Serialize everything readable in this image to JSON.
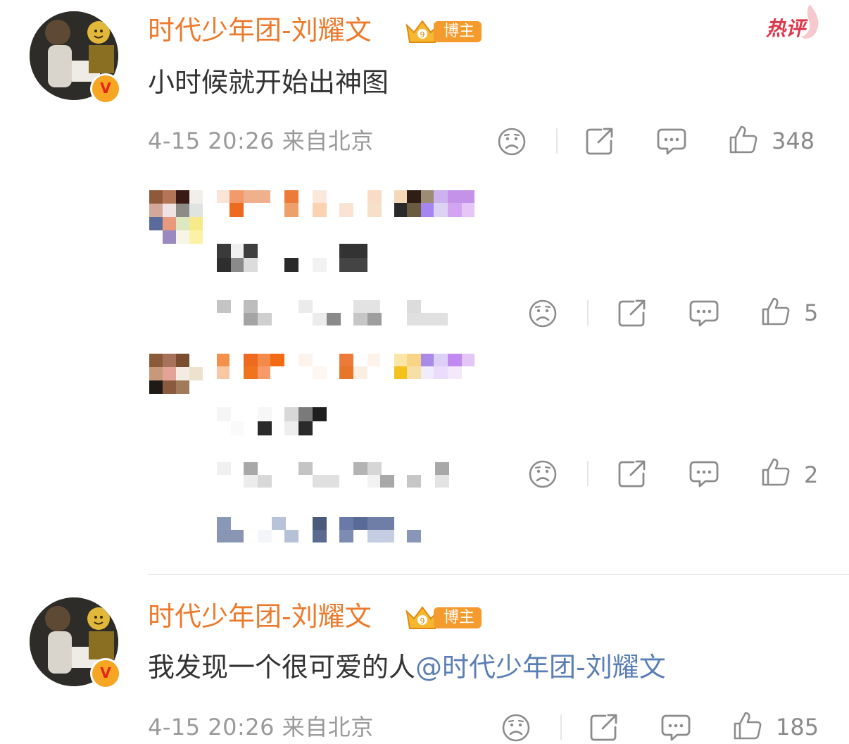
{
  "hot_tag": "热评",
  "comments": [
    {
      "author": "时代少年团-刘耀文",
      "badge": "博主",
      "text": "小时候就开始出神图",
      "meta": "4-15 20:26 来自北京",
      "likes": "348"
    },
    {
      "author": "时代少年团-刘耀文",
      "badge": "博主",
      "text": "我发现一个很可爱的人",
      "mention": "@时代少年团-刘耀文",
      "meta": "4-15 20:26 来自北京",
      "likes": "185"
    }
  ],
  "replies": [
    {
      "likes": "5"
    },
    {
      "likes": "2"
    }
  ],
  "icons": {
    "dislike": "sad-face-icon",
    "share": "share-icon",
    "comment": "comment-icon",
    "like": "thumbs-up-icon",
    "verified": "verified-v-icon",
    "crown": "crown-badge-icon"
  },
  "colors": {
    "author": "#ec7a2c",
    "badge_bg": "#f59a2c",
    "mention": "#5b7fb5",
    "meta": "#9a9a9a",
    "hot": "#e0354a"
  }
}
